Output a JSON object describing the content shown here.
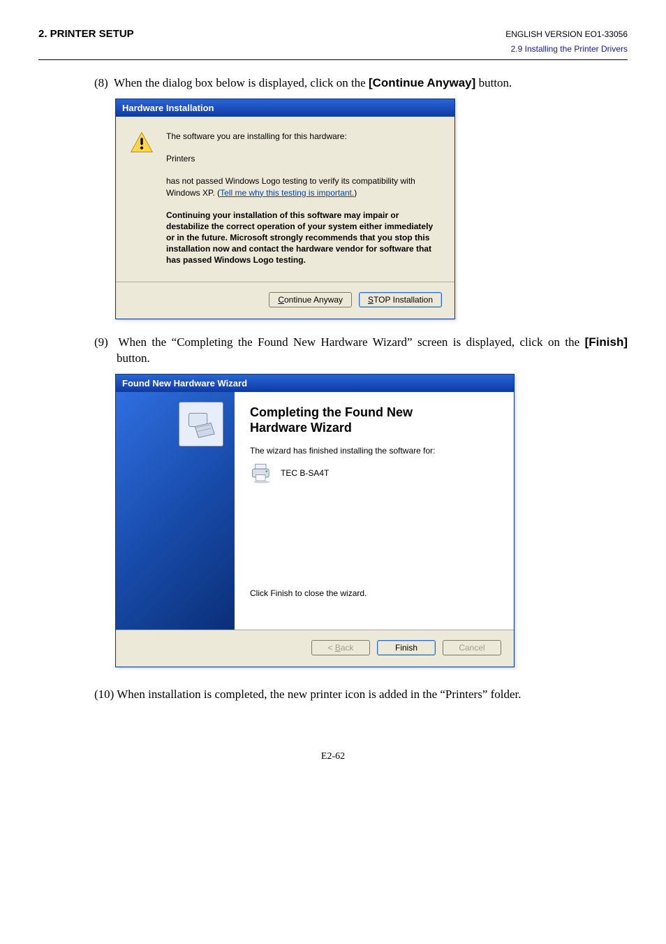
{
  "header": {
    "left": "2. PRINTER SETUP",
    "right": "ENGLISH VERSION EO1-33056",
    "sub": "2.9 Installing the Printer Drivers"
  },
  "step8": {
    "prefix": "(8)",
    "text_a": "When the dialog box below is displayed, click on the ",
    "bold": "[Continue Anyway]",
    "text_b": " button."
  },
  "hw_dialog": {
    "title": "Hardware Installation",
    "line1": "The software you are installing for this hardware:",
    "line2": "Printers",
    "line3a": "has not passed Windows Logo testing to verify its compatibility with Windows XP. (",
    "link": "Tell me why this testing is important.",
    "line3b": ")",
    "strong": "Continuing your installation of this software may impair or destabilize the correct operation of your system either immediately or in the future. Microsoft strongly recommends that you stop this installation now and contact the hardware vendor for software that has passed Windows Logo testing.",
    "btn_continue_pre": "C",
    "btn_continue_rest": "ontinue Anyway",
    "btn_stop_pre": "S",
    "btn_stop_rest": "TOP Installation"
  },
  "step9": {
    "prefix": "(9)",
    "text_a": "When the “Completing the Found New Hardware Wizard” screen is displayed, click on the ",
    "bold": "[Finish]",
    "text_b": " button."
  },
  "wiz_dialog": {
    "title": "Found New Hardware Wizard",
    "heading_a": "Completing the Found New",
    "heading_b": "Hardware Wizard",
    "line1": "The wizard has finished installing the software for:",
    "device": "TEC B-SA4T",
    "finish_note": "Click Finish to close the wizard.",
    "btn_back_pre": "< ",
    "btn_back_u": "B",
    "btn_back_rest": "ack",
    "btn_finish": "Finish",
    "btn_cancel": "Cancel"
  },
  "step10": "(10) When installation is completed, the new printer icon is added in the “Printers” folder.",
  "pageno": "E2-62"
}
